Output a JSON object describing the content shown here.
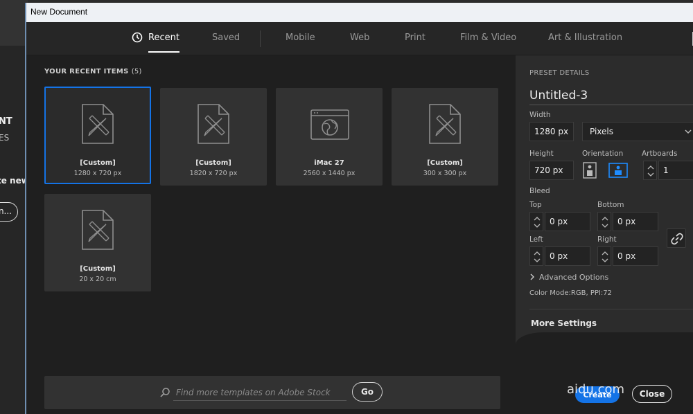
{
  "background_app": {
    "text1": "NT",
    "text2": "ES",
    "text3": "te new",
    "pill_label": "n..."
  },
  "window": {
    "title": "New Document"
  },
  "tabs": [
    {
      "label": "Recent",
      "active": true
    },
    {
      "label": "Saved"
    },
    {
      "label": "Mobile"
    },
    {
      "label": "Web"
    },
    {
      "label": "Print"
    },
    {
      "label": "Film & Video"
    },
    {
      "label": "Art & Illustration"
    }
  ],
  "recent": {
    "heading": "YOUR RECENT ITEMS",
    "count": "(5)",
    "items": [
      {
        "label": "[Custom]",
        "size": "1280 x 720 px",
        "icon": "document-pencil-icon",
        "selected": true
      },
      {
        "label": "[Custom]",
        "size": "1820 x 720 px",
        "icon": "document-pencil-icon"
      },
      {
        "label": "iMac 27",
        "size": "2560 x 1440 px",
        "icon": "web-browser-globe-icon"
      },
      {
        "label": "[Custom]",
        "size": "300 x 300 px",
        "icon": "document-pencil-icon"
      },
      {
        "label": "[Custom]",
        "size": "20 x 20 cm",
        "icon": "document-pencil-icon"
      }
    ]
  },
  "search": {
    "placeholder": "Find more templates on Adobe Stock",
    "go_label": "Go"
  },
  "preset": {
    "heading": "PRESET DETAILS",
    "name": "Untitled-3",
    "width_label": "Width",
    "width_value": "1280 px",
    "unit": "Pixels",
    "height_label": "Height",
    "height_value": "720 px",
    "orientation_label": "Orientation",
    "artboards_label": "Artboards",
    "artboards_value": "1",
    "bleed_label": "Bleed",
    "top_label": "Top",
    "top_value": "0 px",
    "bottom_label": "Bottom",
    "bottom_value": "0 px",
    "left_label": "Left",
    "left_value": "0 px",
    "right_label": "Right",
    "right_value": "0 px",
    "advanced_label": "Advanced Options",
    "color_mode": "Color Mode:RGB, PPI:72",
    "more_settings": "More Settings"
  },
  "actions": {
    "create": "Create",
    "close": "Close"
  },
  "watermark": "aidu.com",
  "colors": {
    "accent": "#1473e6",
    "window_bg": "#1f1f1f",
    "card_bg": "#323232",
    "panel_bg": "#2c2c2c"
  }
}
